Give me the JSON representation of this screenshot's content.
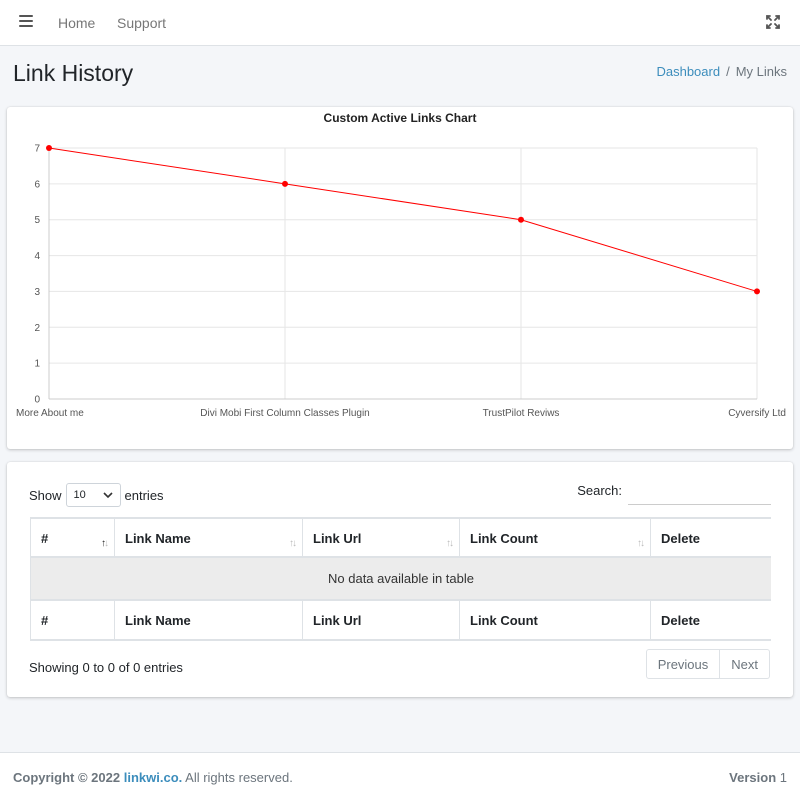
{
  "nav": {
    "home": "Home",
    "support": "Support"
  },
  "page": {
    "title": "Link History"
  },
  "breadcrumb": {
    "dashboard": "Dashboard",
    "separator": "/",
    "current": "My Links"
  },
  "chart_data": {
    "type": "line",
    "title": "Custom Active Links Chart",
    "categories": [
      "More About me",
      "Divi Mobi First Column Classes Plugin",
      "TrustPilot Reviws",
      "Cyversify Ltd"
    ],
    "series": [
      {
        "values": [
          7,
          6,
          5,
          3
        ],
        "color": "#ff0000"
      }
    ],
    "ylim": [
      0,
      7
    ],
    "yticks": [
      0,
      1,
      2,
      3,
      4,
      5,
      6,
      7
    ],
    "grid": true
  },
  "table": {
    "show_label": "Show",
    "entries_label": "entries",
    "page_size": "10",
    "search_label": "Search:",
    "columns": [
      "#",
      "Link Name",
      "Link Url",
      "Link Count",
      "Delete"
    ],
    "empty_message": "No data available in table",
    "info": "Showing 0 to 0 of 0 entries",
    "prev": "Previous",
    "next": "Next"
  },
  "footer": {
    "copyright_prefix": "Copyright © 2022",
    "brand": "linkwi.co.",
    "rights": "All rights reserved.",
    "version_label": "Version",
    "version_number": "1"
  }
}
